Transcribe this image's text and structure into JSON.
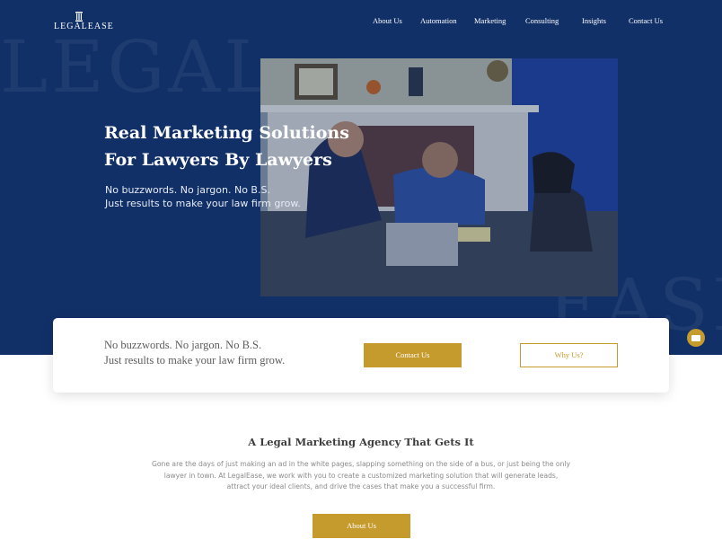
{
  "brand": {
    "logo_text": "LEGALEASE",
    "watermark_left": "LEGAL",
    "watermark_right": "EASE"
  },
  "nav": {
    "items": [
      {
        "label": "About Us"
      },
      {
        "label": "Automation"
      },
      {
        "label": "Marketing"
      },
      {
        "label": "Consulting"
      },
      {
        "label": "Insights"
      },
      {
        "label": "Contact Us"
      }
    ]
  },
  "hero": {
    "headline_lines": [
      "Real Marketing Solutions",
      "For Lawyers By Lawyers"
    ],
    "sub_lines": [
      "No buzzwords. No jargon. No B.S.",
      "Just results to make your law firm grow."
    ]
  },
  "cta_card": {
    "text_lines": [
      "No buzzwords. No jargon. No B.S.",
      "Just results to make your law firm grow."
    ],
    "contact_button": "Contact Us",
    "why_button": "Why Us?"
  },
  "about": {
    "title": "A Legal Marketing Agency That Gets It",
    "body_lines": [
      "Gone are the days of just making an ad in the white pages, slapping something on  the side of a bus, or just being the only",
      "lawyer in town. At LegalEase, we work with you to create a customized marketing solution that will generate leads,",
      "attract your ideal clients, and drive the cases that make you a successful firm."
    ],
    "button": "About Us"
  },
  "colors": {
    "navy": "#123068",
    "gold": "#c69b2e"
  },
  "icons": {
    "chat": "chat-icon",
    "logo": "pillar-icon"
  }
}
